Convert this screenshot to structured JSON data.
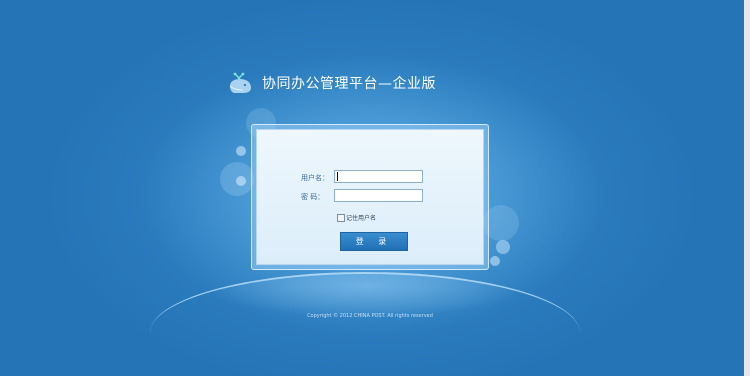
{
  "header": {
    "logo_icon": "whale-icon",
    "title": "协同办公管理平台—企业版"
  },
  "login": {
    "username_label": "用户名：",
    "username_value": "",
    "password_label": "密  码：",
    "password_value": "",
    "remember_label": "记住用户名",
    "remember_checked": false,
    "submit_label": "登 录"
  },
  "footer": {
    "copyright": "Copyright © 2012 CHINA POST. All rights reserved"
  },
  "colors": {
    "background": "#2474b6",
    "button": "#2a7cc0",
    "title_text": "#ffffff"
  }
}
